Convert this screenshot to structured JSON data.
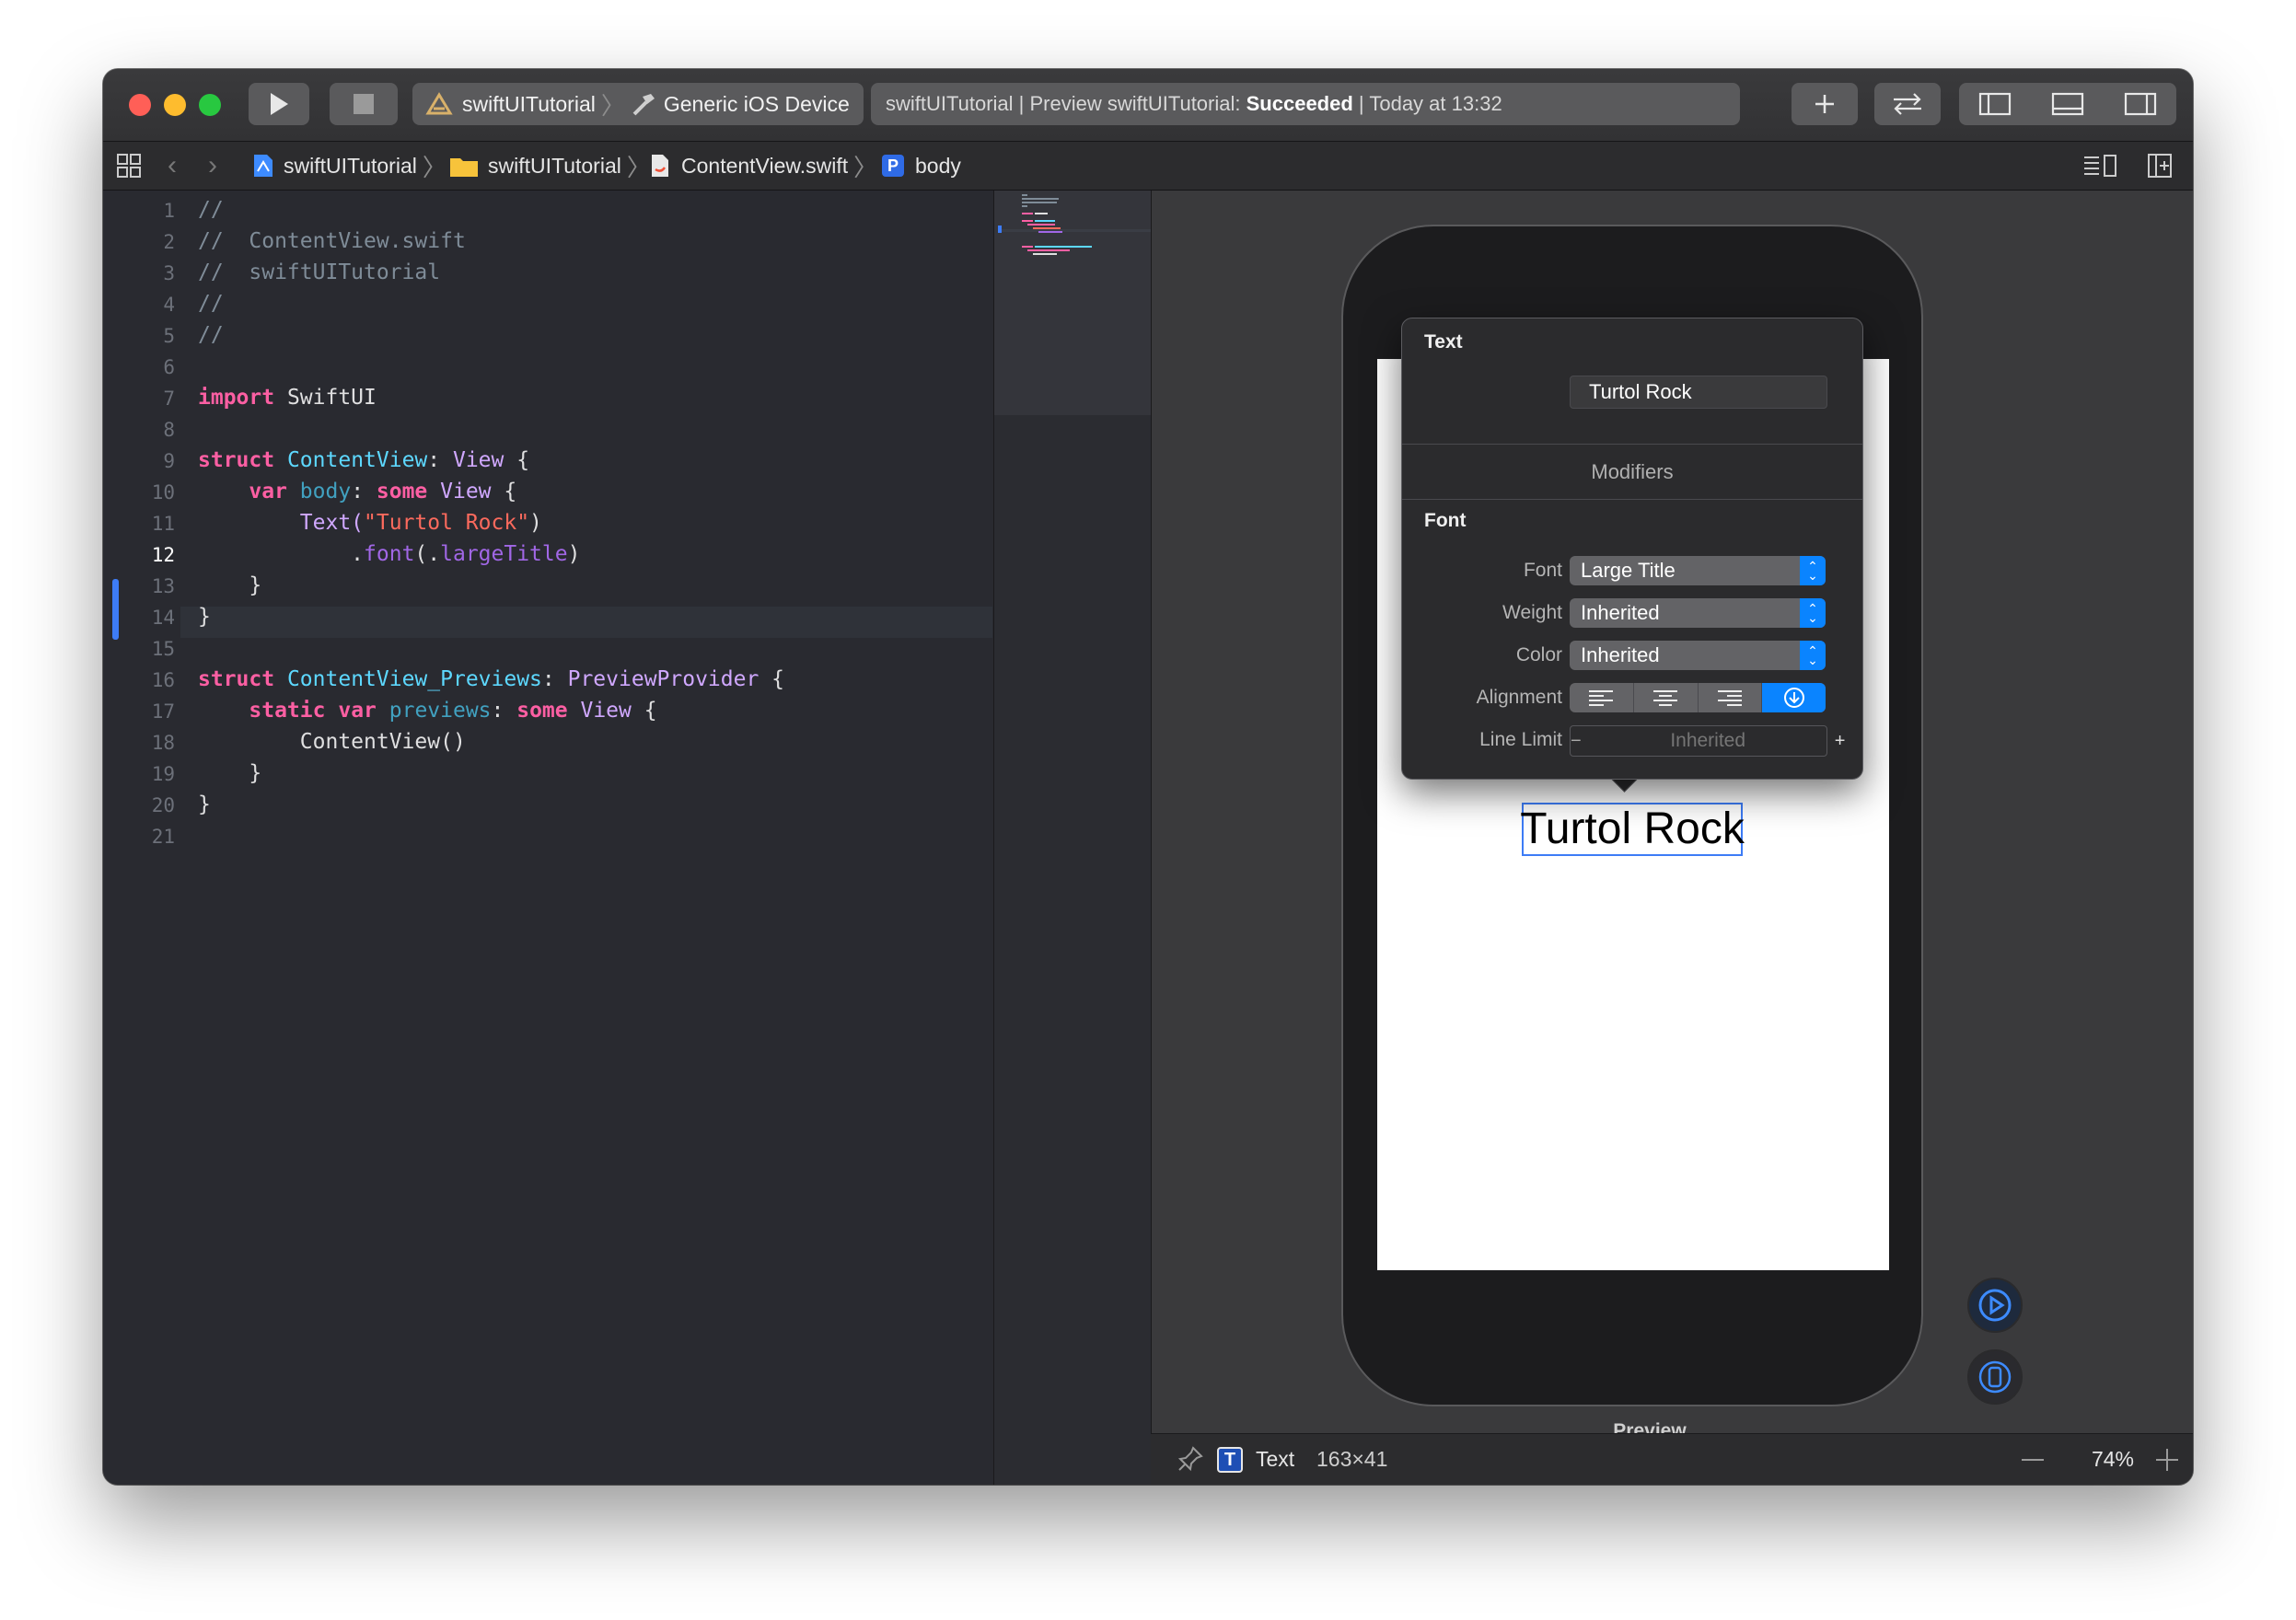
{
  "toolbar": {
    "scheme_project": "swiftUITutorial",
    "scheme_device": "Generic iOS Device",
    "activity_prefix": "swiftUITutorial | Preview swiftUITutorial:",
    "activity_status": "Succeeded",
    "activity_time": "| Today at 13:32"
  },
  "jumpbar": {
    "project": "swiftUITutorial",
    "folder": "swiftUITutorial",
    "file": "ContentView.swift",
    "symbol_badge": "P",
    "symbol": "body"
  },
  "editor": {
    "current_line": 12,
    "line_numbers": [
      "1",
      "2",
      "3",
      "4",
      "5",
      "6",
      "7",
      "8",
      "9",
      "10",
      "11",
      "12",
      "13",
      "14",
      "15",
      "16",
      "17",
      "18",
      "19",
      "20",
      "21"
    ],
    "code": {
      "l1": "//",
      "l2": "//  ContentView.swift",
      "l3": "//  swiftUITutorial",
      "l4": "//",
      "l5": "//",
      "l7_kw": "import",
      "l7_name": " SwiftUI",
      "l9_kw": "struct",
      "l9_name": "ContentView",
      "l9_colon": ": ",
      "l9_type": "View",
      "l9_brace": " {",
      "l10_kw": "var",
      "l10_name": "body",
      "l10_colon": ": ",
      "l10_kw2": "some",
      "l10_type": " View",
      "l10_brace": " {",
      "l11_fn": "Text(",
      "l11_str": "\"Turtol Rock\"",
      "l11_close": ")",
      "l12_dot": ".",
      "l12_fn": "font",
      "l12_open": "(.",
      "l12_arg": "largeTitle",
      "l12_close": ")",
      "l13": "}",
      "l14": "}",
      "l16_kw": "struct",
      "l16_name": "ContentView_Previews",
      "l16_colon": ": ",
      "l16_type": "PreviewProvider",
      "l16_brace": " {",
      "l17_kw": "static",
      "l17_kw2": "var",
      "l17_name": "previews",
      "l17_colon": ": ",
      "l17_kw3": "some",
      "l17_type": " View",
      "l17_brace": " {",
      "l18": "ContentView()",
      "l19": "}",
      "l20": "}"
    }
  },
  "preview": {
    "rendered_text": "Turtol Rock",
    "label_below": "Preview",
    "selection_type": "Text",
    "selection_size": "163×41",
    "zoom": "74%"
  },
  "inspector": {
    "title": "Text",
    "text_value": "Turtol Rock",
    "modifiers_label": "Modifiers",
    "font_section": "Font",
    "font_label": "Font",
    "font_value": "Large Title",
    "weight_label": "Weight",
    "weight_value": "Inherited",
    "color_label": "Color",
    "color_value": "Inherited",
    "alignment_label": "Alignment",
    "line_limit_label": "Line Limit",
    "line_limit_placeholder": "Inherited",
    "minus": "−",
    "plus": "+"
  },
  "colors": {
    "accent": "#0a84ff",
    "close": "#ff5f57",
    "minimize": "#febc2e",
    "zoom": "#28c840"
  }
}
